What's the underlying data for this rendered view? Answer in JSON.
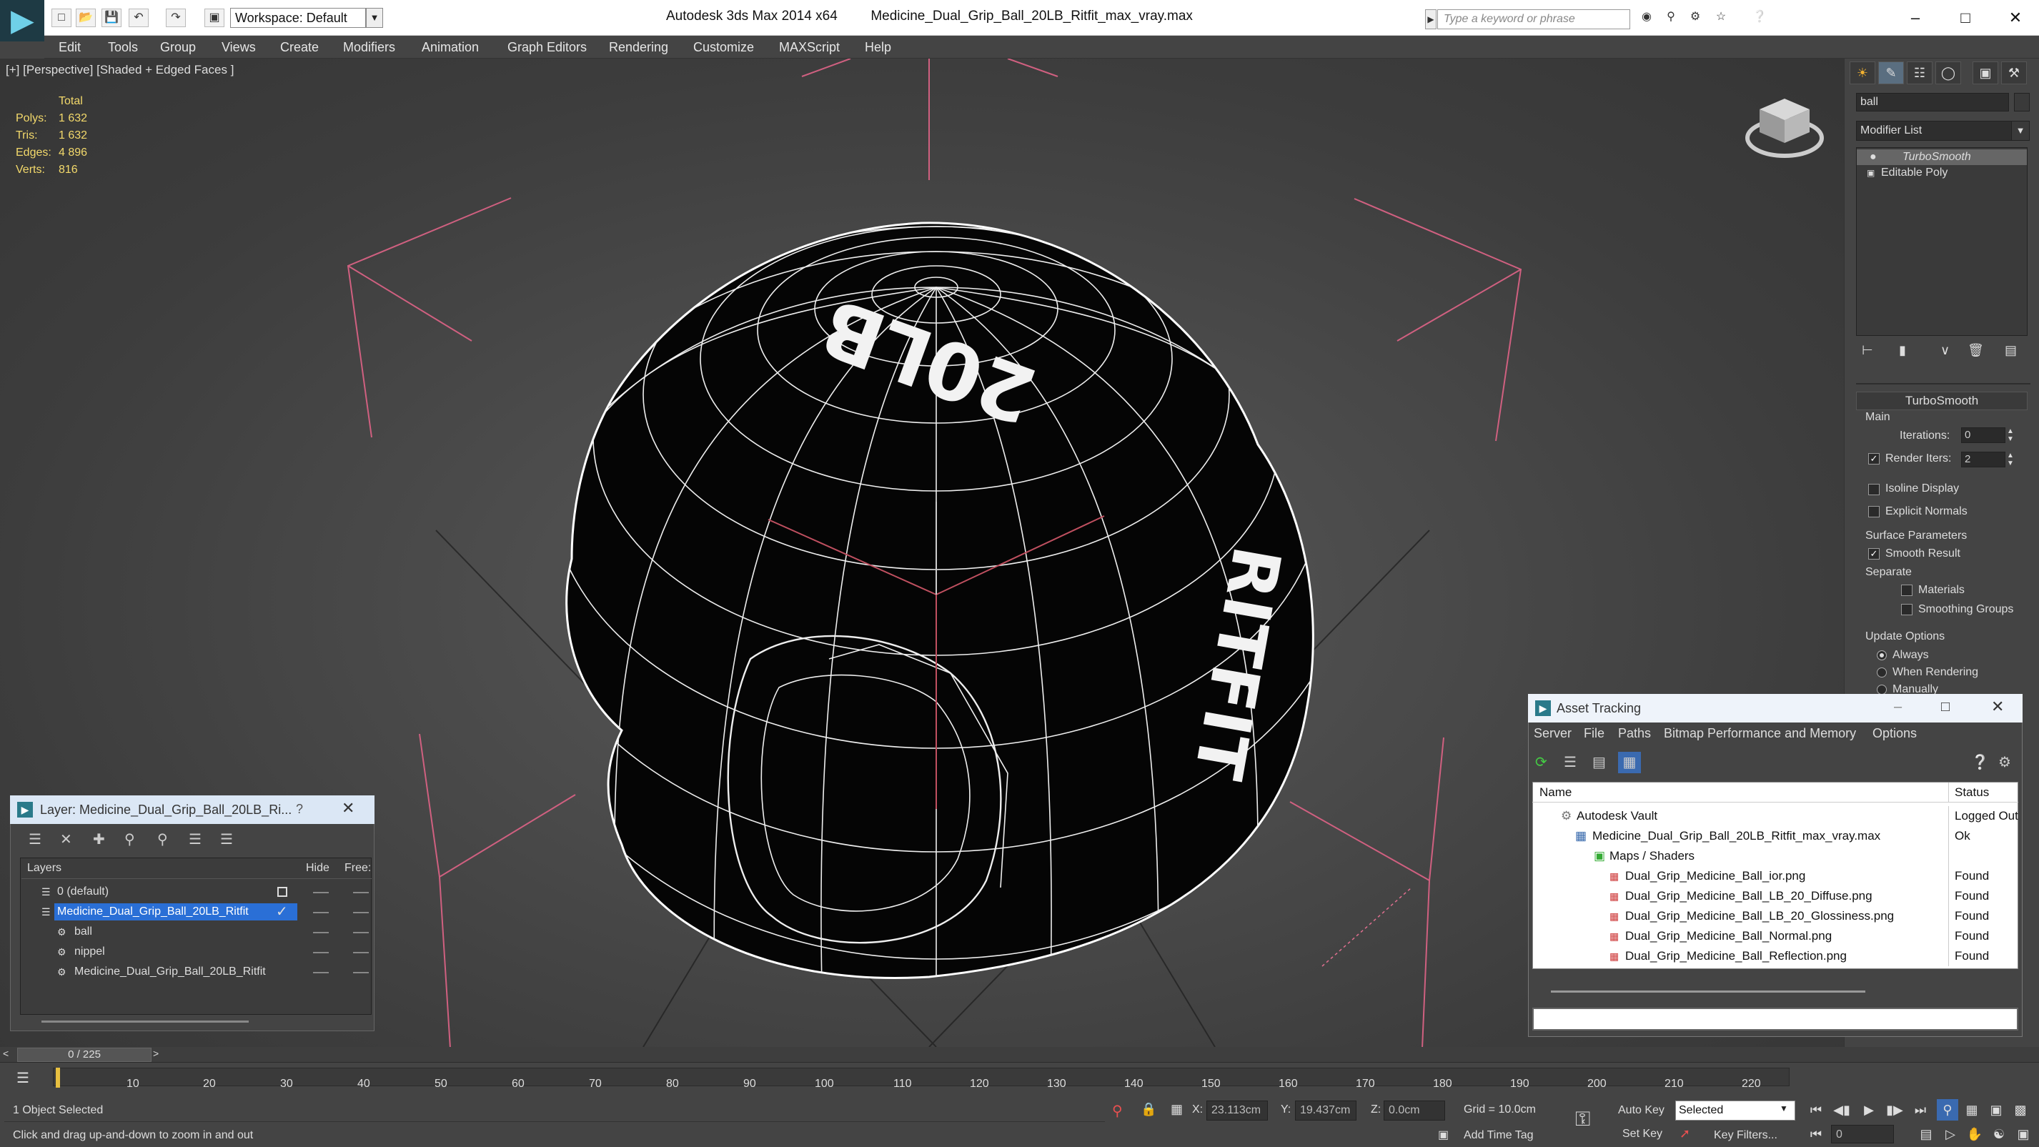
{
  "app": {
    "name": "Autodesk 3ds Max  2014 x64",
    "file": "Medicine_Dual_Grip_Ball_20LB_Ritfit_max_vray.max",
    "workspace": "Workspace: Default",
    "search_placeholder": "Type a keyword or phrase"
  },
  "menu": [
    "Edit",
    "Tools",
    "Group",
    "Views",
    "Create",
    "Modifiers",
    "Animation",
    "Graph Editors",
    "Rendering",
    "Customize",
    "MAXScript",
    "Help"
  ],
  "viewport": {
    "label": "[+] [Perspective] [Shaded + Edged Faces ]",
    "stats_header": "Total",
    "stats": [
      {
        "label": "Polys:",
        "value": "1 632"
      },
      {
        "label": "Tris:",
        "value": "1 632"
      },
      {
        "label": "Edges:",
        "value": "4 896"
      },
      {
        "label": "Verts:",
        "value": "816"
      }
    ],
    "ball_text_top": "20LB",
    "ball_text_side": "RITFIT"
  },
  "command_panel": {
    "object_name": "ball",
    "modifier_list": "Modifier List",
    "stack": [
      "TurboSmooth",
      "Editable Poly"
    ],
    "rollout": "TurboSmooth",
    "main_label": "Main",
    "iterations_label": "Iterations:",
    "iterations": "0",
    "render_iters_label": "Render Iters:",
    "render_iters": "2",
    "isoline": "Isoline Display",
    "explicit_normals": "Explicit Normals",
    "surface_params": "Surface Parameters",
    "smooth_result": "Smooth Result",
    "separate": "Separate",
    "materials": "Materials",
    "smoothing_groups": "Smoothing Groups",
    "update_options": "Update Options",
    "always": "Always",
    "when_rendering": "When Rendering",
    "manually": "Manually"
  },
  "layer_window": {
    "title": "Layer: Medicine_Dual_Grip_Ball_20LB_Ri...",
    "help": "?",
    "col_layers": "Layers",
    "col_hide": "Hide",
    "col_freeze": "Free:",
    "rows": [
      {
        "name": "0 (default)",
        "selected": false
      },
      {
        "name": "Medicine_Dual_Grip_Ball_20LB_Ritfit",
        "selected": true
      },
      {
        "name": "ball",
        "selected": false
      },
      {
        "name": "nippel",
        "selected": false
      },
      {
        "name": "Medicine_Dual_Grip_Ball_20LB_Ritfit",
        "selected": false
      }
    ]
  },
  "asset_tracking": {
    "title": "Asset Tracking",
    "menu": [
      "Server",
      "File",
      "Paths",
      "Bitmap Performance and Memory",
      "Options"
    ],
    "col_name": "Name",
    "col_status": "Status",
    "rows": [
      {
        "name": "Autodesk Vault",
        "status": "Logged Out"
      },
      {
        "name": "Medicine_Dual_Grip_Ball_20LB_Ritfit_max_vray.max",
        "status": "Ok"
      },
      {
        "name": "Maps / Shaders",
        "status": ""
      },
      {
        "name": "Dual_Grip_Medicine_Ball_ior.png",
        "status": "Found"
      },
      {
        "name": "Dual_Grip_Medicine_Ball_LB_20_Diffuse.png",
        "status": "Found"
      },
      {
        "name": "Dual_Grip_Medicine_Ball_LB_20_Glossiness.png",
        "status": "Found"
      },
      {
        "name": "Dual_Grip_Medicine_Ball_Normal.png",
        "status": "Found"
      },
      {
        "name": "Dual_Grip_Medicine_Ball_Reflection.png",
        "status": "Found"
      }
    ]
  },
  "timeline": {
    "frame_counter": "0 / 225",
    "ticks": [
      "10",
      "20",
      "30",
      "40",
      "50",
      "60",
      "70",
      "80",
      "90",
      "100",
      "110",
      "120",
      "130",
      "140",
      "150",
      "160",
      "170",
      "180",
      "190",
      "200",
      "210",
      "220"
    ]
  },
  "status": {
    "selection": "1 Object Selected",
    "prompt": "Click and drag up-and-down to zoom in and out",
    "x_label": "X:",
    "x": "23.113cm",
    "y_label": "Y:",
    "y": "19.437cm",
    "z_label": "Z:",
    "z": "0.0cm",
    "grid": "Grid = 10.0cm",
    "add_time_tag": "Add Time Tag",
    "auto_key": "Auto Key",
    "set_key": "Set Key",
    "key_selected": "Selected",
    "key_filters": "Key Filters...",
    "frame": "0"
  }
}
